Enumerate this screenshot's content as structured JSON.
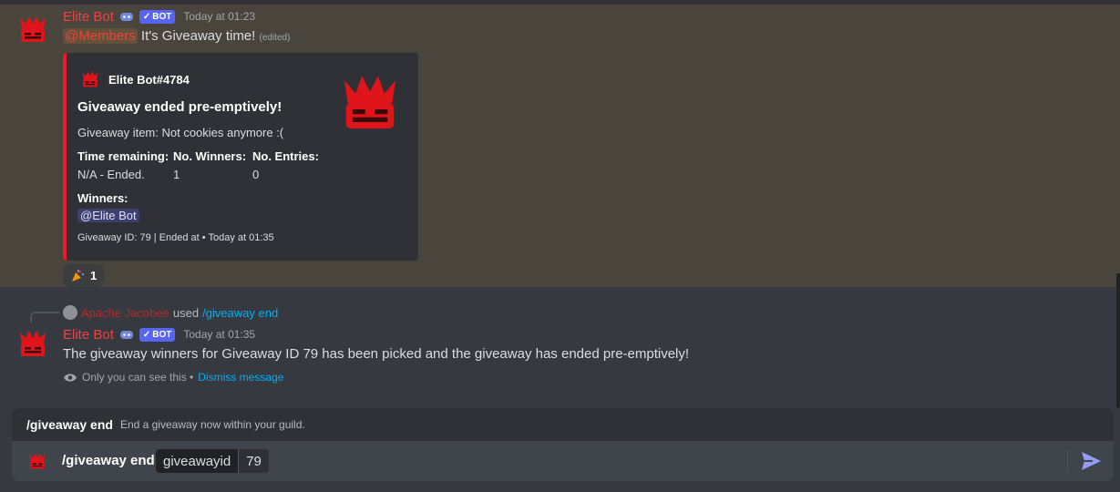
{
  "colors": {
    "accent": "#ed4245",
    "embed_border": "#ed1c24",
    "blurple": "#5865f2",
    "link": "#00aff4"
  },
  "msg1": {
    "author": "Elite Bot",
    "bot_tag": "BOT",
    "timestamp": "Today at 01:23",
    "mention": "@Members",
    "content": "It's Giveaway time!",
    "edited": "(edited)",
    "embed": {
      "author": "Elite Bot#4784",
      "title": "Giveaway ended pre-emptively!",
      "description": "Giveaway item: Not cookies anymore :(",
      "fields": [
        {
          "name": "Time remaining:",
          "value": "N/A - Ended."
        },
        {
          "name": "No. Winners:",
          "value": "1"
        },
        {
          "name": "No. Entries:",
          "value": "0"
        }
      ],
      "winners_label": "Winners:",
      "winner": "@Elite Bot",
      "footer": "Giveaway ID: 79 | Ended at • Today at 01:35"
    },
    "reaction": {
      "emoji": "party-popper-icon",
      "count": "1"
    }
  },
  "msg2": {
    "reply_user": "Apache Jacobee",
    "reply_used": "used",
    "reply_command": "/giveaway end",
    "author": "Elite Bot",
    "bot_tag": "BOT",
    "timestamp": "Today at 01:35",
    "content": "The giveaway winners for Giveaway ID 79 has been picked and the giveaway has ended pre-emptively!",
    "ephemeral_note": "Only you can see this •",
    "dismiss": "Dismiss message"
  },
  "command_hint": {
    "name": "/giveaway end",
    "description": "End a giveaway now within your guild."
  },
  "composer": {
    "typed": "/giveaway end",
    "option_name": "giveawayid",
    "option_value": "79"
  }
}
